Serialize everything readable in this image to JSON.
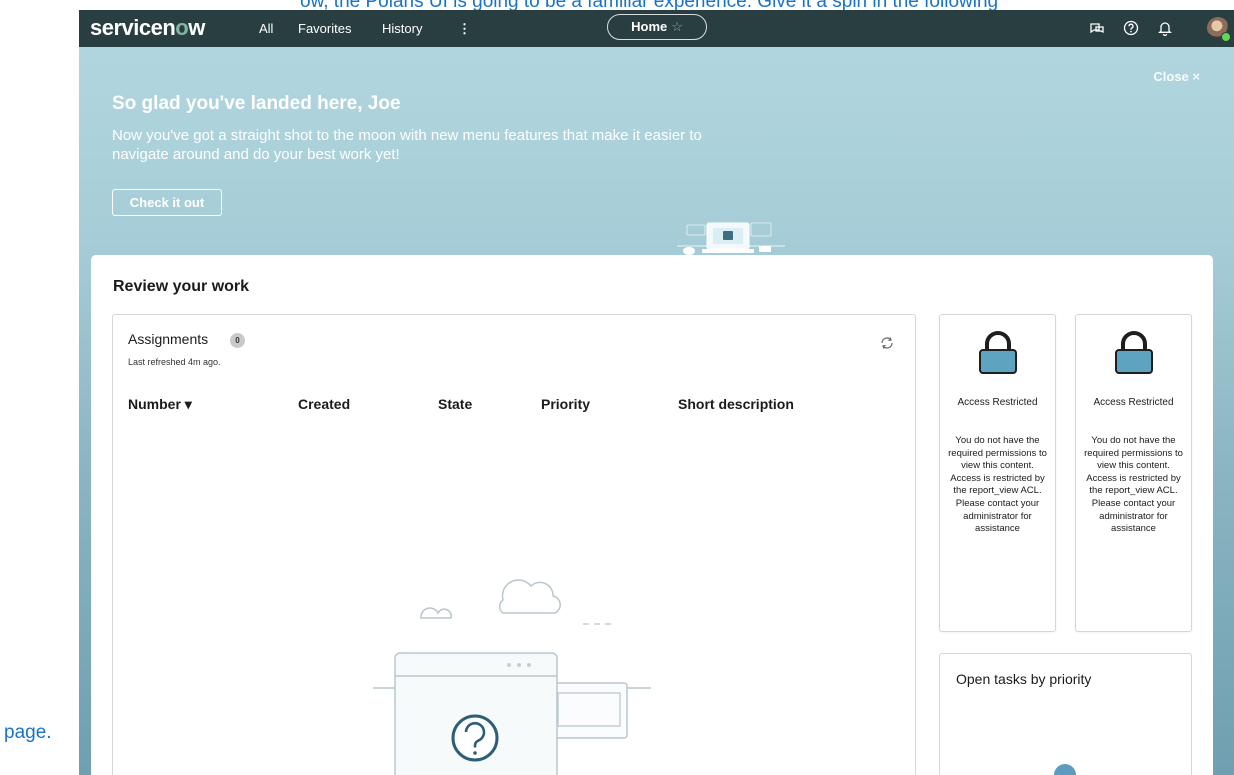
{
  "outer": {
    "top_line": "ow, the Polaris UI is going to be a familiar experience. Give it a spin in the following",
    "bottom_word": "page."
  },
  "nav": {
    "logo_prefix": "servicen",
    "logo_o": "o",
    "logo_suffix": "w",
    "items": [
      "All",
      "Favorites",
      "History"
    ],
    "more": "⋮",
    "home": "Home",
    "home_star": "☆",
    "icons": [
      "chat-icon",
      "help-icon",
      "bell-icon",
      "avatar"
    ]
  },
  "banner": {
    "close": "Close ×",
    "title": "So glad you've landed here, Joe",
    "text": "Now you've got a straight shot to the moon with new menu features that make it easier to navigate around and do your best work yet!",
    "button": "Check it out"
  },
  "review": {
    "title": "Review your work",
    "assignments": {
      "title": "Assignments",
      "count": "0",
      "refreshed": "Last refreshed 4m ago.",
      "columns": [
        "Number ▾",
        "Created",
        "State",
        "Priority",
        "Short description"
      ]
    },
    "restricted": [
      {
        "title": "Access Restricted",
        "text": "You do not have the required permissions to view this content. Access is restricted by the report_view ACL. Please contact your administrator for assistance"
      },
      {
        "title": "Access Restricted",
        "text": "You do not have the required permissions to view this content. Access is restricted by the report_view ACL. Please contact your administrator for assistance"
      }
    ],
    "open_tasks": {
      "title": "Open tasks by priority"
    }
  },
  "colors": {
    "navbar": "#293e40",
    "accent": "#81b5a1",
    "lock": "#5ea3bf",
    "banner": "#a6cdd7"
  }
}
